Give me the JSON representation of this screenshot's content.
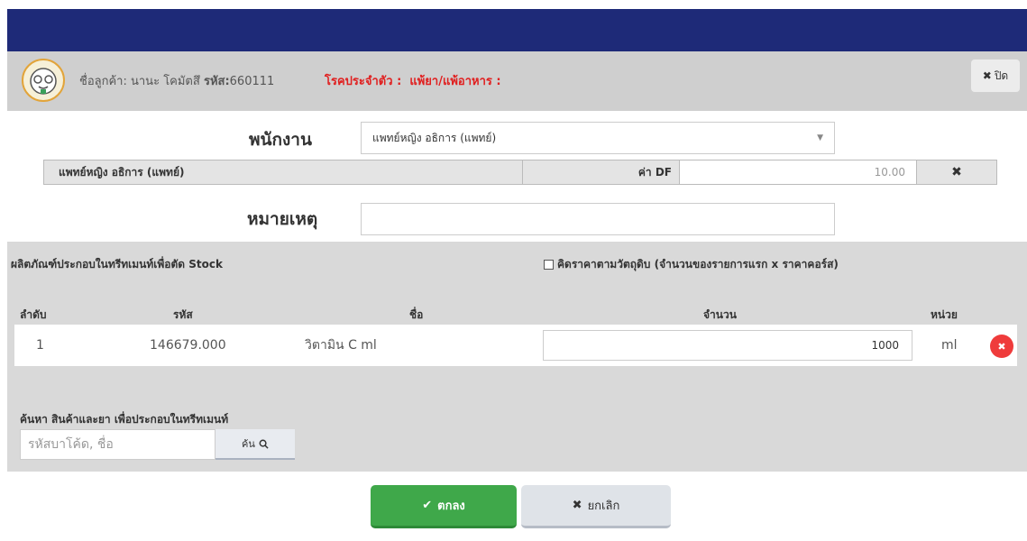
{
  "header": {
    "customer_label": "ชื่อลูกค้า:",
    "customer_name": "นานะ โคมัตสึ",
    "code_label": "รหัส:",
    "code_value": "660111",
    "disease_label": "โรคประจำตัว :",
    "allergy_label": "แพ้ยา/แพ้อาหาร :",
    "close_label": "ปิด"
  },
  "form": {
    "staff_label": "พนักงาน",
    "staff_selected": "แพทย์หญิง อธิการ (แพทย์)",
    "df_staff_name": "แพทย์หญิง อธิการ (แพทย์)",
    "df_label": "ค่า DF",
    "df_value": "10.00",
    "note_label": "หมายเหตุ",
    "note_value": ""
  },
  "stock": {
    "title": "ผลิตภัณฑ์ประกอบในทรีทเมนท์เพื่อตัด Stock",
    "calc_checkbox_label": "คิดราคาตามวัตถุดิบ (จำนวนของรายการแรก x ราคาคอร์ส)",
    "columns": [
      "ลำดับ",
      "รหัส",
      "ชื่อ",
      "จำนวน",
      "หน่วย"
    ],
    "rows": [
      {
        "no": "1",
        "code": "146679.000",
        "name": "วิตามิน C ml",
        "qty": "1000",
        "unit": "ml"
      }
    ],
    "search_title": "ค้นหา สินค้าและยา เพื่อประกอบในทรีทเมนท์",
    "search_placeholder": "รหัสบาโค้ด, ชื่อ",
    "search_button": "ค้น"
  },
  "footer": {
    "ok_label": "ตกลง",
    "cancel_label": "ยกเลิก"
  },
  "colors": {
    "topbar": "#1e2a78",
    "header_bg": "#cfcfcf",
    "disease_text": "#e02020",
    "ok_button": "#3fa84a",
    "delete_button": "#ef3b3b"
  }
}
